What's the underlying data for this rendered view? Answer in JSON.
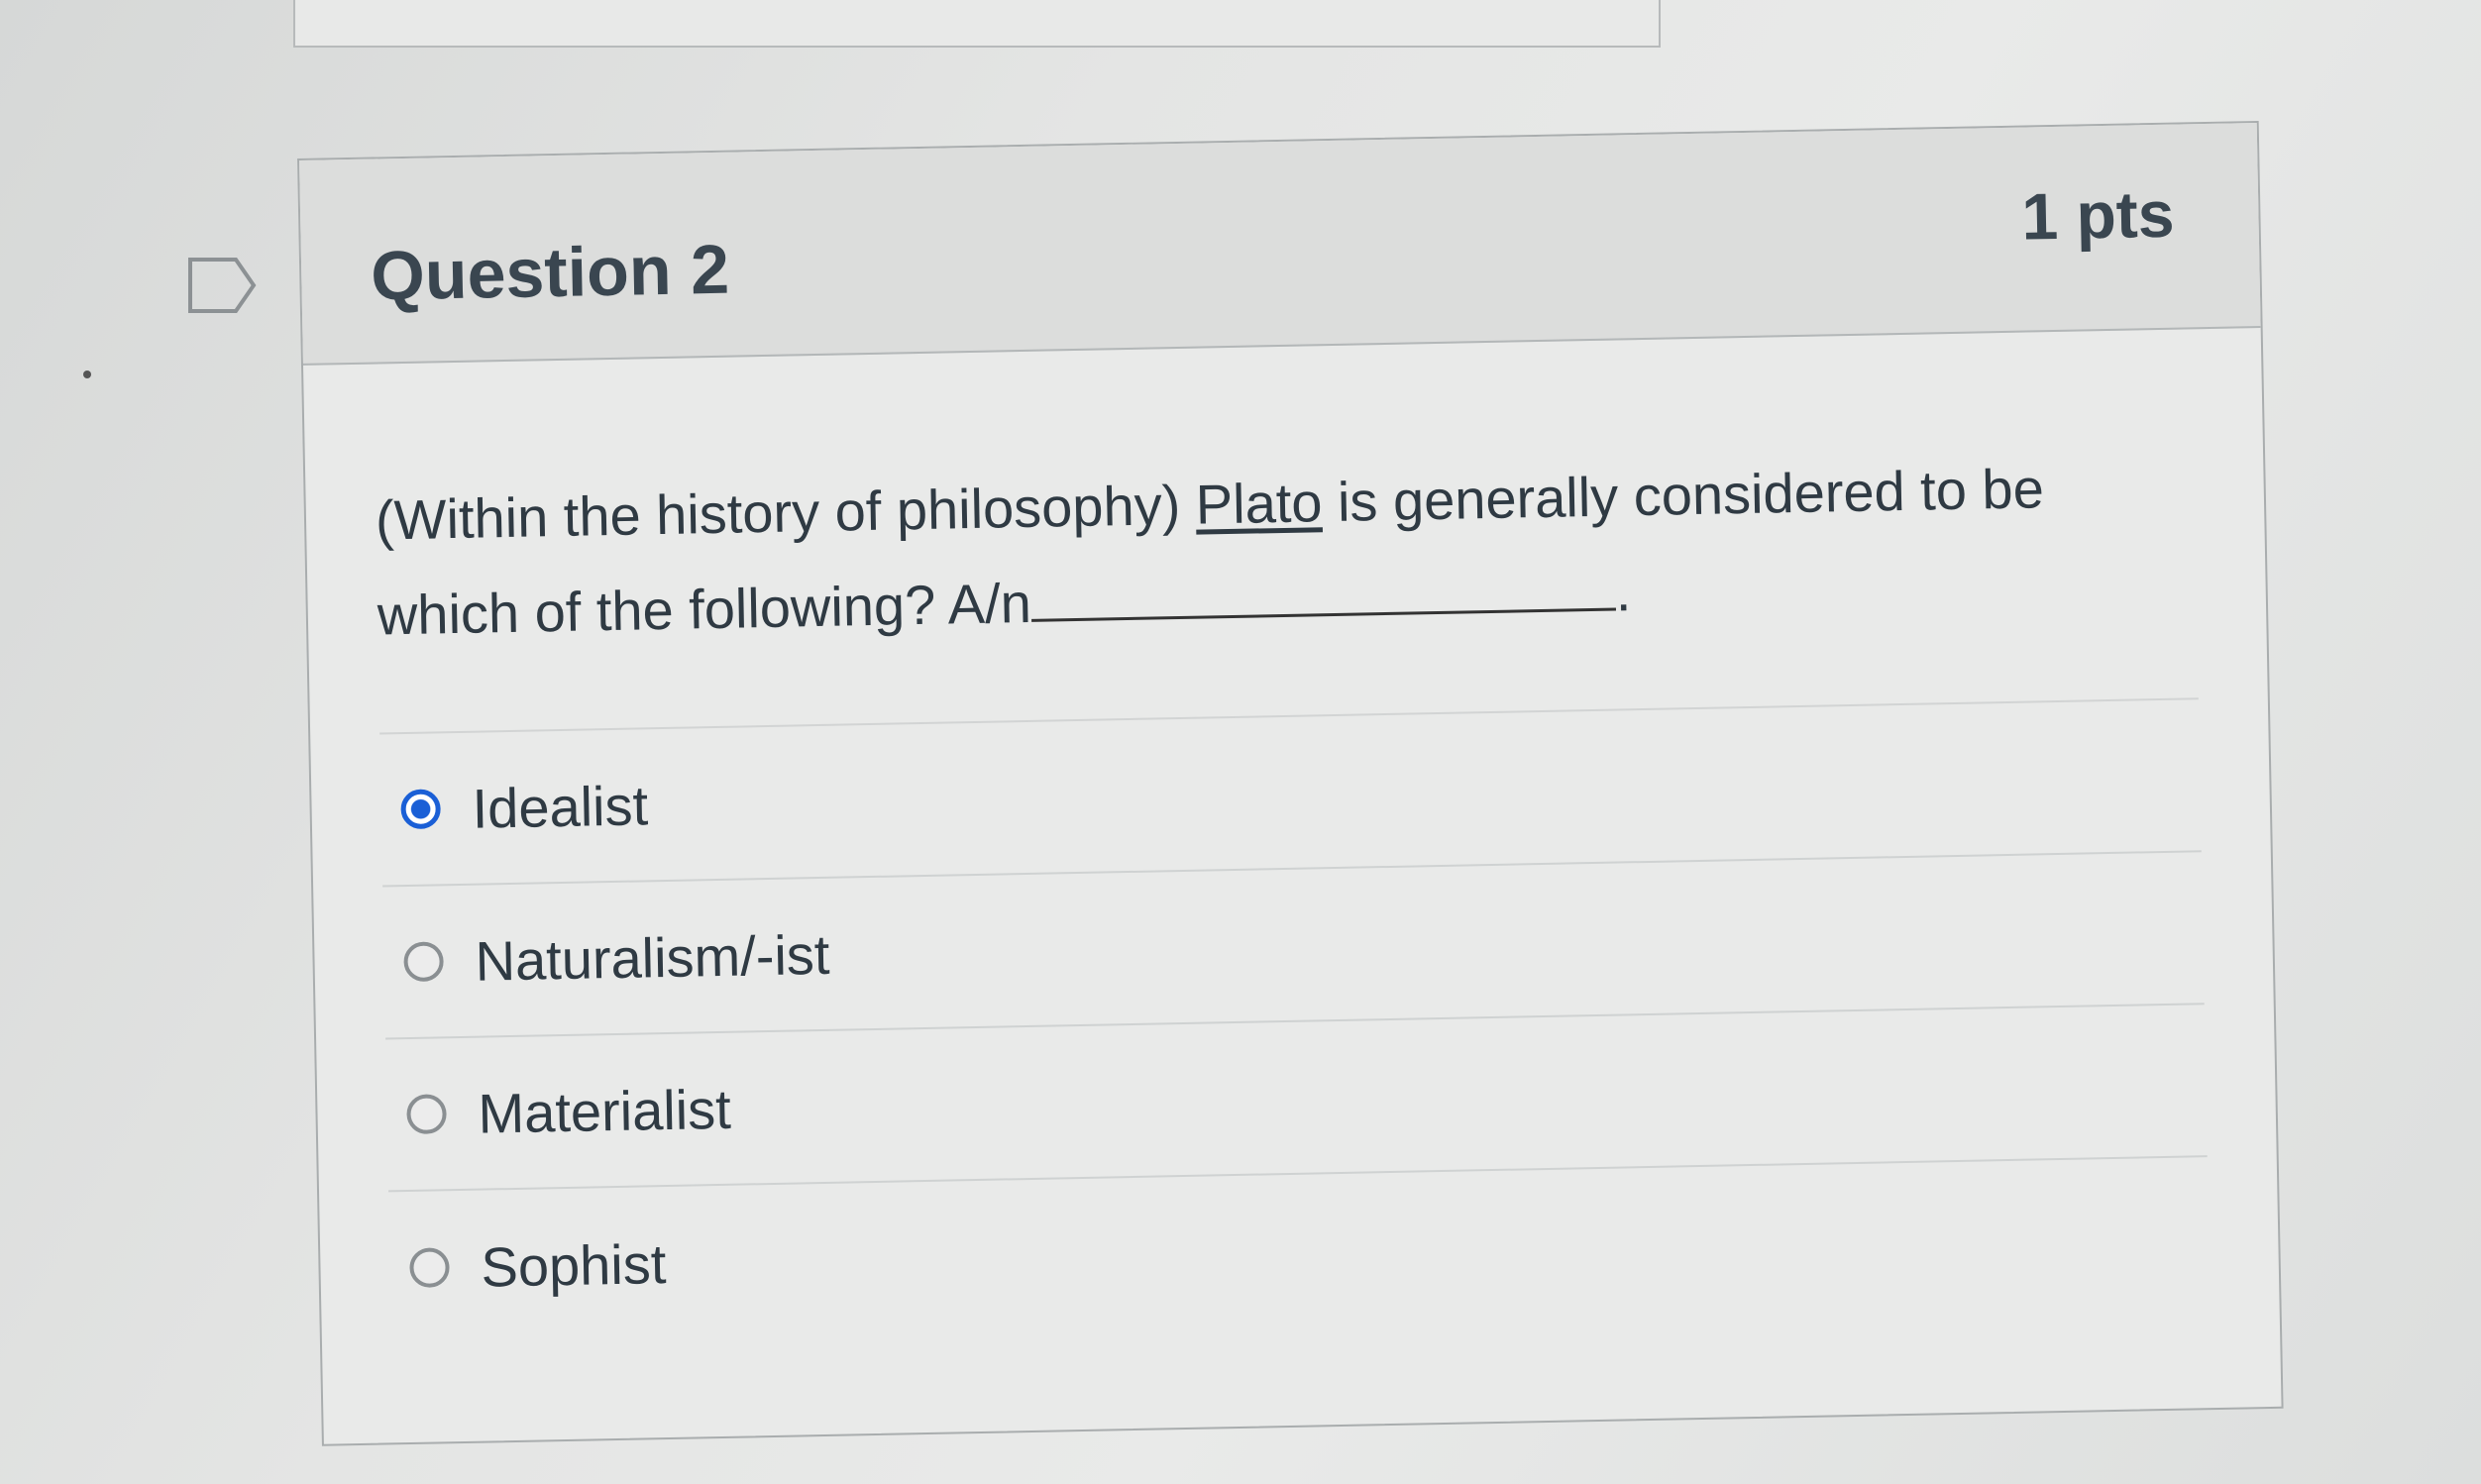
{
  "question": {
    "title": "Question 2",
    "points": "1 pts",
    "text_prefix": "(Within the history of philosophy) ",
    "text_link": "Plato",
    "text_middle": " is generally considered  to be which of the following? A/n",
    "text_suffix": "."
  },
  "answers": [
    {
      "label": "Idealist",
      "selected": true
    },
    {
      "label": "Naturalism/-ist",
      "selected": false
    },
    {
      "label": "Materialist",
      "selected": false
    },
    {
      "label": "Sophist",
      "selected": false
    }
  ],
  "icons": {
    "flag": "flag-question-icon"
  },
  "colors": {
    "selected_radio": "#1a5fd6",
    "header_bg": "#dcdddc"
  }
}
